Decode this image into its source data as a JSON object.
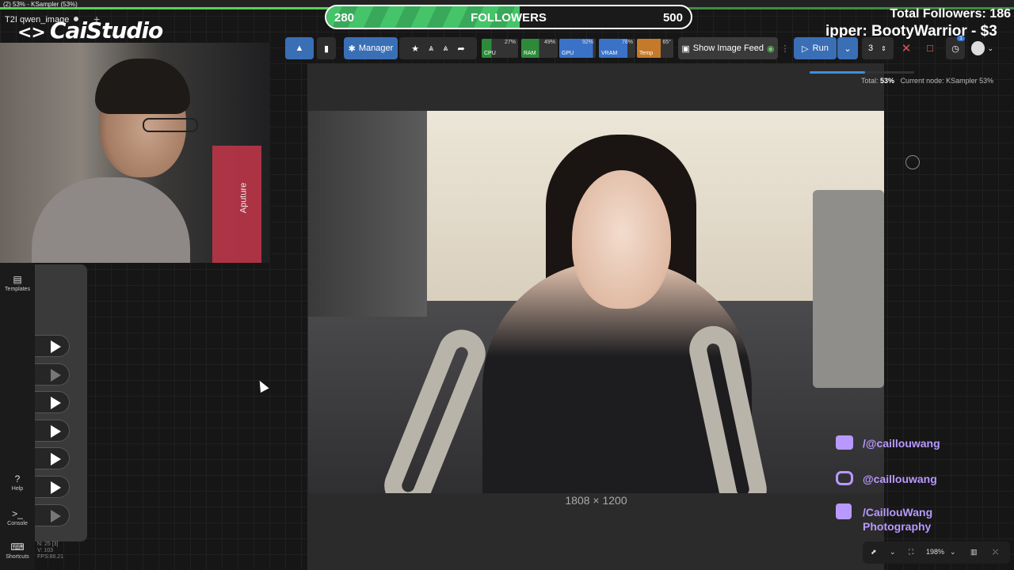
{
  "window": {
    "title": "(2) 53% - KSampler (53%)",
    "title_progress": 0.53,
    "tab_title": "T2I qwen_image",
    "new_tab_symbol": "+"
  },
  "overlay": {
    "logo_text": "CaiStudio",
    "followers_bar": {
      "start": "280",
      "label": "FOLLOWERS",
      "goal": "500",
      "fill_fraction": 0.53
    },
    "total_followers": "Total Followers: 186",
    "ticker_text": "ipper: BootyWarrior - $3",
    "socials": [
      {
        "platform": "youtube",
        "icon": "youtube-icon",
        "text": "/@caillouwang",
        "color": "#b899ff"
      },
      {
        "platform": "instagram",
        "icon": "instagram-icon",
        "text": "@caillouwang",
        "color": "#b899ff"
      },
      {
        "platform": "facebook",
        "icon": "facebook-icon",
        "text": "/CaillouWang Photography",
        "color": "#b899ff"
      }
    ]
  },
  "toolbar": {
    "manager_label": "Manager",
    "meters": [
      {
        "label": "CPU",
        "value": "27%",
        "level": 0.27,
        "color": "#2e8a3a"
      },
      {
        "label": "RAM",
        "value": "49%",
        "level": 0.49,
        "color": "#2e8a3a"
      },
      {
        "label": "GPU",
        "value": "92%",
        "level": 0.92,
        "color": "#3a72c8"
      },
      {
        "label": "VRAM",
        "value": "78%",
        "level": 0.78,
        "color": "#3a72c8"
      },
      {
        "label": "Temp",
        "value": "65°",
        "level": 0.65,
        "color": "#c47a2a"
      }
    ],
    "image_feed_label": "Show Image Feed",
    "run_label": "Run",
    "batch_count": "3",
    "queue_badge": "1"
  },
  "progress": {
    "total_label": "Total:",
    "total_value": "53%",
    "current_node": "Current node: KSampler 53%",
    "fraction": 0.53
  },
  "image": {
    "dimensions": "1808 × 1200"
  },
  "sidebar": {
    "templates_label": "Templates",
    "help_label": "Help",
    "console_label": "Console",
    "shortcuts_label": "Shortcuts"
  },
  "stats": {
    "nodes": "N: 25 [3]",
    "v": "V: 103",
    "fps": "FPS:86.21"
  },
  "canvas_tools": {
    "zoom": "198%"
  },
  "webcam": {
    "stand_label": "Aputure"
  }
}
